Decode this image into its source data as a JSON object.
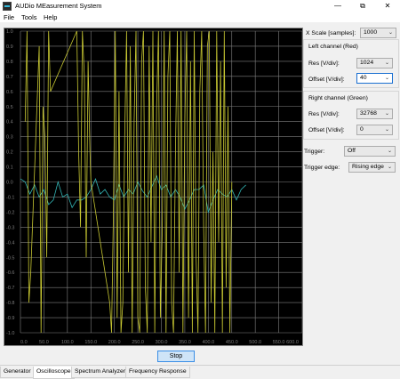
{
  "window": {
    "title": "AUDio MEasurement System",
    "minimize_glyph": "—",
    "maximize_glyph": "⧉",
    "close_glyph": "✕"
  },
  "menu": {
    "file": "File",
    "tools": "Tools",
    "help": "Help"
  },
  "controls": {
    "x_scale_label": "X Scale [samples]:",
    "x_scale_value": "1000",
    "left_channel_title": "Left channel (Red)",
    "left_res_label": "Res [V/div]:",
    "left_res_value": "1024",
    "left_offset_label": "Offset [V/div]:",
    "left_offset_value": "40",
    "right_channel_title": "Right channel (Green)",
    "right_res_label": "Res [V/div]:",
    "right_res_value": "32768",
    "right_offset_label": "Offset [V/div]:",
    "right_offset_value": "0",
    "trigger_label": "Trigger:",
    "trigger_value": "Off",
    "trigger_edge_label": "Trigger edge:",
    "trigger_edge_value": "Rising edge"
  },
  "stop_button": "Stop",
  "tabs": [
    "Generator",
    "Oscilloscope",
    "Spectrum Analyzer",
    "Frequency Response"
  ],
  "active_tab": "Oscilloscope",
  "colors": {
    "grid": "#808080",
    "yellow_trace": "#c8c832",
    "cyan_trace": "#32b4b4",
    "axis_text": "#7a7a7a"
  },
  "chart_data": {
    "type": "line",
    "x_ticks": [
      "0.0",
      "50.0",
      "100.0",
      "150.0",
      "200.0",
      "250.0",
      "300.0",
      "350.0",
      "400.0",
      "450.0",
      "500.0",
      "550.0",
      "600.0"
    ],
    "y_ticks": [
      "1.0",
      "0.9",
      "0.8",
      "0.7",
      "0.6",
      "0.5",
      "0.4",
      "0.3",
      "0.2",
      "0.1",
      "0.0",
      "-0.1",
      "-0.2",
      "-0.3",
      "-0.4",
      "-0.5",
      "-0.6",
      "-0.7",
      "-0.8",
      "-0.9",
      "-1.0"
    ],
    "xlim": [
      0,
      600
    ],
    "ylim": [
      -1,
      1
    ],
    "series": [
      {
        "color": "cyan",
        "x": [
          0,
          10,
          20,
          30,
          40,
          50,
          60,
          70,
          80,
          90,
          100,
          110,
          120,
          130,
          140,
          150,
          160,
          170,
          180,
          190,
          200,
          210,
          220,
          230,
          240,
          250,
          260,
          270,
          280,
          290,
          300,
          310,
          320,
          330,
          340,
          350,
          360,
          370,
          380,
          390,
          400,
          410,
          420,
          430,
          440,
          450,
          460,
          470,
          480
        ],
        "y": [
          0.02,
          0.0,
          -0.08,
          -0.02,
          -0.1,
          -0.05,
          -0.15,
          -0.12,
          0.0,
          -0.1,
          -0.08,
          -0.17,
          -0.12,
          -0.12,
          -0.1,
          -0.05,
          0.02,
          -0.08,
          -0.05,
          -0.1,
          -0.12,
          -0.02,
          -0.1,
          -0.05,
          -0.08,
          0.0,
          -0.06,
          -0.1,
          -0.03,
          0.04,
          -0.05,
          -0.02,
          -0.1,
          -0.05,
          -0.1,
          -0.18,
          -0.12,
          -0.05,
          -0.05,
          -0.02,
          -0.2,
          -0.12,
          -0.05,
          -0.08,
          -0.1,
          -0.05,
          -0.12,
          -0.05,
          -0.02
        ]
      },
      {
        "color": "yellow",
        "x": [
          10,
          14,
          18,
          22,
          40,
          44,
          48,
          52,
          56,
          60,
          64,
          120,
          124,
          128,
          132,
          136,
          140,
          144,
          148,
          150,
          190,
          194,
          198,
          202,
          206,
          210,
          214,
          218,
          222,
          226,
          230,
          234,
          238,
          242,
          246,
          250,
          254,
          258,
          262,
          266,
          270,
          274,
          278,
          282,
          286,
          290,
          294,
          298,
          302,
          306,
          310,
          314,
          318,
          322,
          326,
          330,
          334,
          338,
          342,
          346,
          350,
          354,
          358,
          362,
          366,
          370,
          374,
          378,
          382,
          386,
          390,
          394,
          398,
          402,
          406,
          410,
          414,
          418,
          422,
          426,
          430,
          434,
          438,
          442,
          446,
          450
        ],
        "y": [
          0.4,
          1.0,
          -0.8,
          -0.6,
          0.9,
          -1.0,
          0.5,
          0.3,
          -0.5,
          1.0,
          0.6,
          1.0,
          0.2,
          -0.3,
          1.0,
          0.7,
          -0.5,
          0.8,
          0.2,
          0.0,
          -0.8,
          -1.0,
          -0.2,
          1.0,
          -0.9,
          0.6,
          -1.0,
          -0.8,
          0.3,
          1.0,
          -0.6,
          0.9,
          -1.0,
          0.4,
          1.0,
          -0.9,
          -1.0,
          0.8,
          1.0,
          -0.7,
          -1.0,
          0.9,
          -0.4,
          1.0,
          -1.0,
          0.5,
          1.0,
          -0.9,
          -0.3,
          1.0,
          -1.0,
          0.7,
          1.0,
          -0.8,
          -1.0,
          0.2,
          1.0,
          -0.6,
          1.0,
          -1.0,
          0.4,
          1.0,
          -0.9,
          0.8,
          -1.0,
          1.0,
          -0.5,
          -1.0,
          0.6,
          1.0,
          -0.3,
          -1.0,
          0.9,
          1.0,
          -0.8,
          0.2,
          -1.0,
          1.0,
          -0.4,
          0.8,
          -1.0,
          1.0,
          -0.7,
          0.5,
          -1.0,
          0.0
        ]
      }
    ]
  }
}
